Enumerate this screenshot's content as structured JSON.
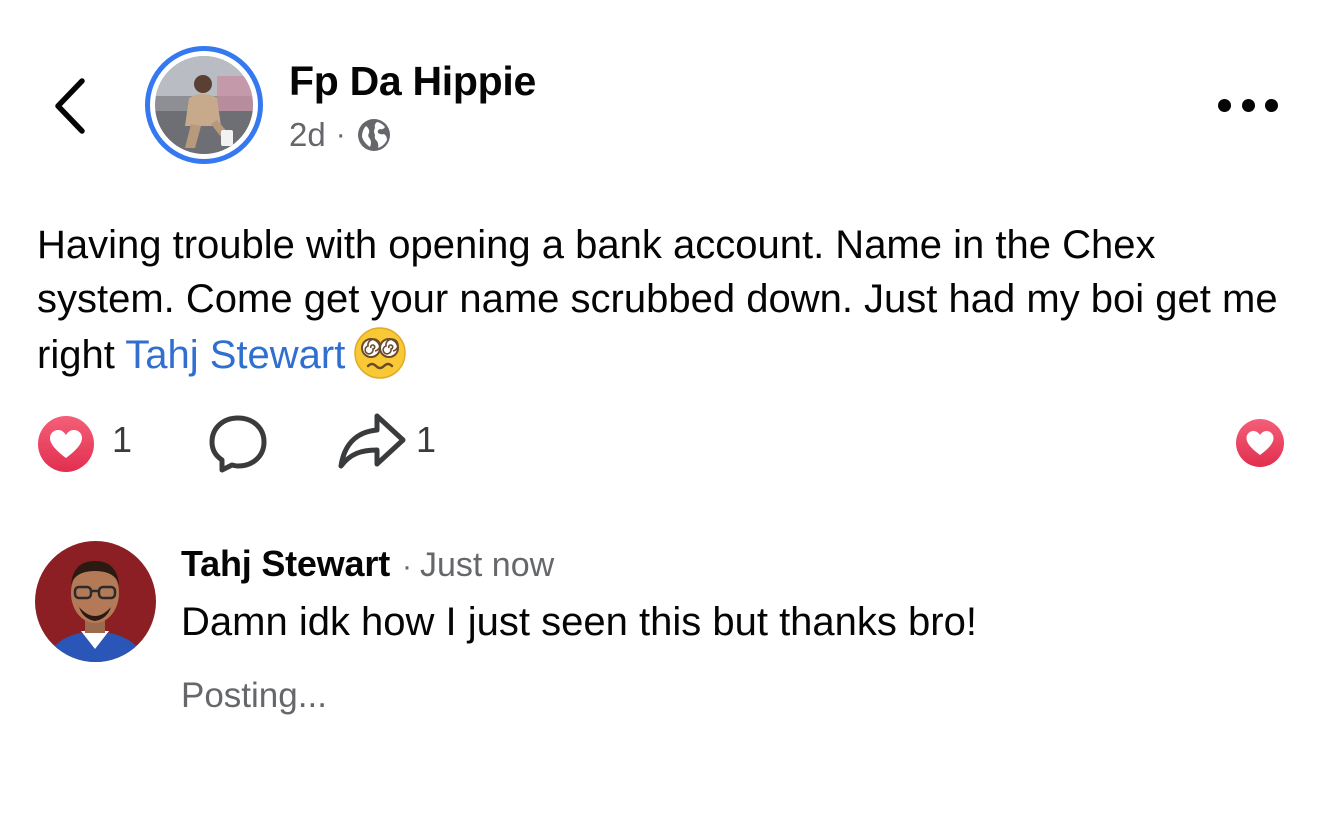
{
  "post": {
    "author_name": "Fp Da Hippie",
    "timestamp": "2d",
    "separator": "·",
    "privacy_icon": "globe-icon",
    "text_before_mention": "Having trouble with opening a bank account. Name in the Chex system. Come get your name scrubbed down. Just had my boi get me right ",
    "mention": "Tahj Stewart",
    "emoji": "face-with-spiral-eyes"
  },
  "actions": {
    "reaction_count": "1",
    "share_count": "1"
  },
  "comment": {
    "author_name": "Tahj Stewart",
    "separator": "·",
    "time": "Just now",
    "text": "Damn idk how I just seen this but thanks bro!",
    "status": "Posting..."
  },
  "colors": {
    "accent_blue": "#3578f0",
    "mention_blue": "#2f6fcf",
    "reaction_red": "#e8405a",
    "secondary_text": "#65676b"
  }
}
